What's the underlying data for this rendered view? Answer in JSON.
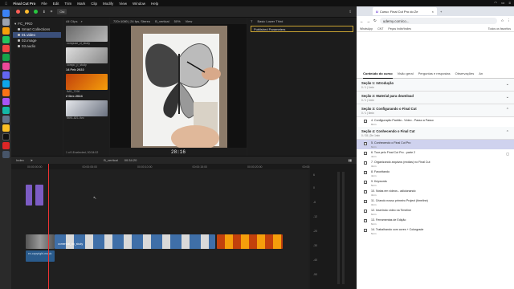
{
  "menubar": {
    "app": "Final Cut Pro",
    "items": [
      "File",
      "Edit",
      "Trim",
      "Mark",
      "Clip",
      "Modify",
      "View",
      "Window",
      "Help"
    ]
  },
  "fcp": {
    "toolbar": {
      "button": "Oki"
    },
    "sidebar": {
      "library": "FC_PRO",
      "items": [
        "Smart Collections",
        "01.video",
        "02.image",
        "03.audio"
      ]
    },
    "browser": {
      "filter": "All Clips",
      "clips": [
        {
          "name": "compuse_cl_study"
        },
        {
          "name": "compo_p_study"
        }
      ],
      "groups": [
        {
          "date": "14 Feb 2022",
          "clips": [
            "IMG_7290"
          ]
        },
        {
          "date": "2 Dec 2024",
          "clips": [
            "5691-821-9vo"
          ]
        }
      ],
      "status": "1 of 18 selected, 00:34:02"
    },
    "viewer": {
      "format": "720×1080 | 24 fps, Stereo",
      "clip_name": "B_vertical",
      "zoom": "50%",
      "view": "View",
      "timecode": "28:16"
    },
    "inspector": {
      "title": "Basic Lower Third",
      "field": "Published Parameters"
    },
    "timeline": {
      "index": "Index",
      "project": "B_vertical",
      "duration": "00:34:20",
      "ruler": [
        "00:00:00:00",
        "00:00:05:00",
        "00:00:10:00",
        "00:00:15:00",
        "00:00:20:00",
        "00:00:25:00"
      ],
      "clip_label": "comercial_do_study",
      "audio_label": "ex-copyright-music"
    },
    "meters": {
      "labels": [
        "6",
        "0",
        "-6",
        "-12",
        "-20",
        "-30",
        "-40",
        "-50"
      ]
    }
  },
  "chrome": {
    "tab_title": "Curso: Final Cut Pro do Ze",
    "url": "udemy.com/co...",
    "bookmarks": [
      "WhatsApp",
      "CNT",
      "Peças Indie/Indies",
      "Todos os favoritos"
    ],
    "course_tabs": [
      "Conteúdo do curso",
      "Visão geral",
      "Perguntas e respostas",
      "Observações",
      "An"
    ],
    "sections": [
      {
        "title": "Seção 1: Introdução",
        "sub": "0 / 1 | 1min",
        "lectures": []
      },
      {
        "title": "Seção 2: Material para download",
        "sub": "0 / 1 | 1min",
        "lectures": []
      },
      {
        "title": "Seção 3: Configurando o Final Cut",
        "sub": "0 / 1 | 8min",
        "lectures": [
          {
            "t": "4. Configuração Padrão - Vídeo - Passo a Passo",
            "s": "8min",
            "cur": false
          }
        ]
      },
      {
        "title": "Seção 4: Conhecendo o Final Cut",
        "sub": "0 / 28 | 2hr 1min",
        "lectures": [
          {
            "t": "5. Conhecendo o Final Cut Pro",
            "s": "6min",
            "cur": true
          },
          {
            "t": "6. Tour pelo Final Cut Pro - parte 2",
            "s": "4min",
            "cur": false
          },
          {
            "t": "7. Organizando arquivos (mídias) no Final Cut",
            "s": "3min",
            "cur": false
          },
          {
            "t": "8. Favoritando",
            "s": "4min",
            "cur": false
          },
          {
            "t": "9. Keywords",
            "s": "5min",
            "cur": false
          },
          {
            "t": "10. Notas em vídeos - adicionando",
            "s": "3min",
            "cur": false
          },
          {
            "t": "11. Criando nosso primeiro Project (timeline)",
            "s": "3min",
            "cur": false
          },
          {
            "t": "12. Inserindo vídeo na Timeline",
            "s": "6min",
            "cur": false
          },
          {
            "t": "13. Ferramentas de Edição",
            "s": "6min",
            "cur": false
          },
          {
            "t": "14. Trabalhando com cores + Colorgrade",
            "s": "5min",
            "cur": false
          }
        ]
      }
    ],
    "colors": {
      "accent": "#5624d0",
      "highlight": "#cfd2ee"
    }
  }
}
